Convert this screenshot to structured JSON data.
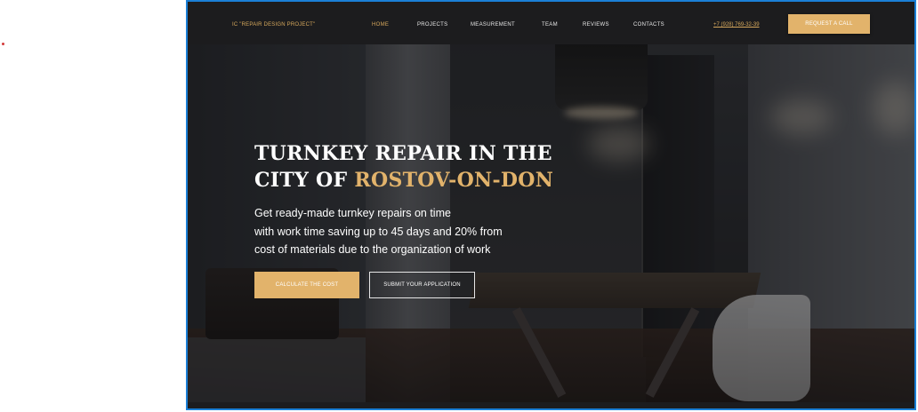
{
  "nav": {
    "logo": "IC \"REPAIR DESIGN PROJECT\"",
    "items": [
      "HOME",
      "PROJECTS",
      "MEASUREMENT",
      "TEAM",
      "REVIEWS",
      "CONTACTS"
    ],
    "active_item": "HOME",
    "phone": "+7 (928) 769-32-39",
    "cta": "REQUEST A CALL"
  },
  "hero": {
    "title_line1": "TURNKEY REPAIR IN THE",
    "title_line2_prefix": "CITY OF",
    "title_line2_accent": "ROSTOV-ON-DON",
    "subtitle_lines": [
      "Get ready-made turnkey repairs on time",
      "with work time saving up to 45 days and 20% from",
      "cost of materials due to the organization of work"
    ],
    "primary_button": "CALCULATE THE COST",
    "secondary_button": "SUBMIT YOUR APPLICATION"
  },
  "colors": {
    "accent": "#e2b36b",
    "nav_bg": "#1c1c1e",
    "frame_border": "#1b7fd6"
  }
}
